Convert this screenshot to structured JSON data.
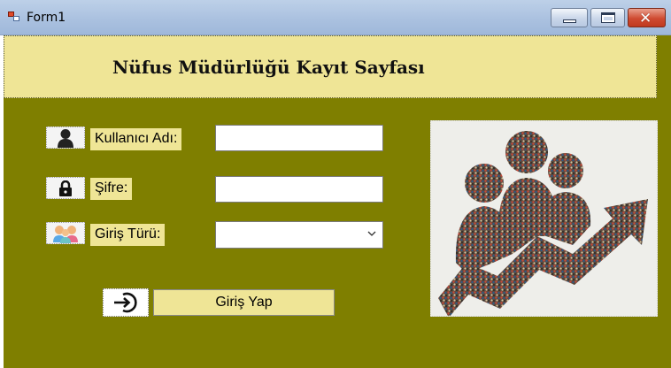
{
  "window": {
    "title": "Form1",
    "close_glyph": "✕"
  },
  "header": {
    "title": "Nüfus Müdürlüğü Kayıt Sayfası"
  },
  "form": {
    "username_label": "Kullanıcı Adı:",
    "username_value": "",
    "password_label": "Şifre:",
    "password_value": "",
    "login_type_label": "Giriş Türü:",
    "login_type_selected": "",
    "login_button_label": "Giriş Yap"
  },
  "icons": {
    "user": "user-icon",
    "lock": "lock-icon",
    "people": "people-icon",
    "login": "login-icon"
  },
  "colors": {
    "form_background": "#7f7f00",
    "panel_background": "#efe596",
    "close_button": "#cf4a31"
  }
}
